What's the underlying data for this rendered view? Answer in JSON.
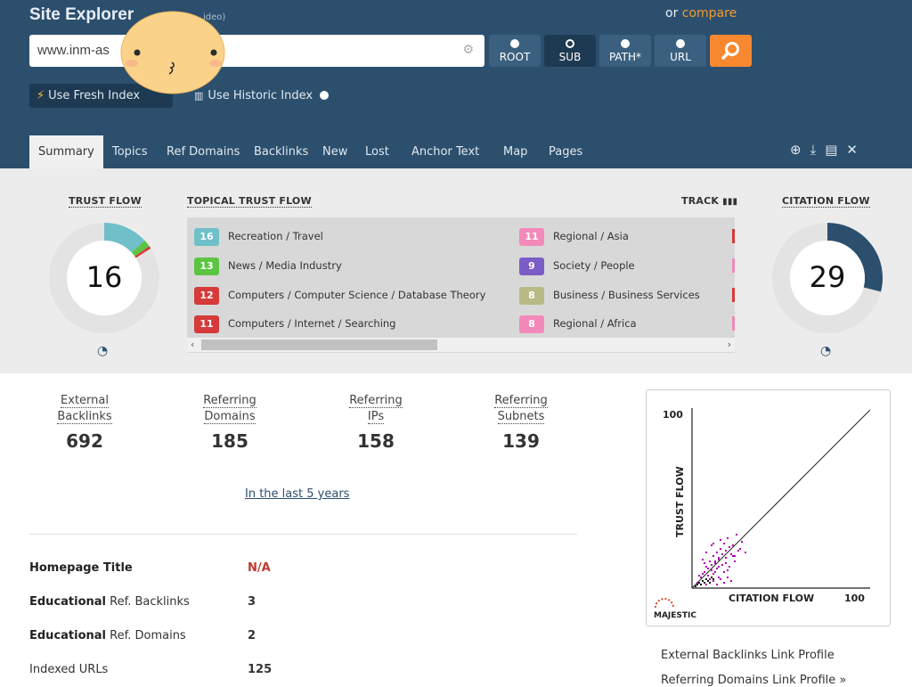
{
  "header": {
    "title": "Site Explorer",
    "title_suffix": "ideo)",
    "or_text": "or ",
    "compare_link": "compare",
    "search_value": "www.inm-as",
    "scopes": [
      {
        "label": "ROOT",
        "active": false
      },
      {
        "label": "SUB",
        "active": true
      },
      {
        "label": "PATH*",
        "active": false
      },
      {
        "label": "URL",
        "active": false
      }
    ],
    "fresh_index": "Use Fresh Index",
    "historic_index": "Use Historic Index"
  },
  "tabs": [
    "Summary",
    "Topics",
    "Ref Domains",
    "Backlinks",
    "New",
    "Lost",
    "Anchor Text",
    "Map",
    "Pages"
  ],
  "metrics": {
    "trust_flow_label": "TRUST FLOW",
    "trust_flow": "16",
    "topical_label": "TOPICAL TRUST FLOW",
    "track_label": "TRACK",
    "citation_flow_label": "CITATION FLOW",
    "citation_flow": "29",
    "topics": [
      {
        "score": "16",
        "name": "Recreation / Travel",
        "color": "#6fc0c8"
      },
      {
        "score": "13",
        "name": "News / Media Industry",
        "color": "#5cc443"
      },
      {
        "score": "12",
        "name": "Computers / Computer Science / Database Theory",
        "color": "#d63a3a"
      },
      {
        "score": "11",
        "name": "Computers / Internet / Searching",
        "color": "#d63a3a"
      },
      {
        "score": "11",
        "name": "Regional / Asia",
        "color": "#f389b8"
      },
      {
        "score": "9",
        "name": "Society / People",
        "color": "#7a5cc7"
      },
      {
        "score": "8",
        "name": "Business / Business Services",
        "color": "#b8ba86"
      },
      {
        "score": "8",
        "name": "Regional / Africa",
        "color": "#f389b8"
      }
    ]
  },
  "stats": [
    {
      "line1": "External",
      "line2": "Backlinks",
      "value": "692"
    },
    {
      "line1": "Referring",
      "line2": "Domains",
      "value": "185"
    },
    {
      "line1": "Referring",
      "line2": "IPs",
      "value": "158"
    },
    {
      "line1": "Referring",
      "line2": "Subnets",
      "value": "139"
    }
  ],
  "last_years": "In the last 5 years",
  "info": [
    {
      "bold": "Homepage Title",
      "rest": "",
      "value": "N/A",
      "value_color": "#c0392b"
    },
    {
      "bold": "Educational",
      "rest": " Ref. Backlinks",
      "value": "3",
      "value_color": "#333"
    },
    {
      "bold": "Educational",
      "rest": " Ref. Domains",
      "value": "2",
      "value_color": "#333"
    },
    {
      "bold": "",
      "rest": "Indexed URLs",
      "value": "125",
      "value_color": "#333"
    }
  ],
  "chart_data": {
    "type": "scatter",
    "xlabel": "CITATION FLOW",
    "ylabel": "TRUST FLOW",
    "xlim": [
      0,
      100
    ],
    "ylim": [
      0,
      100
    ],
    "x_tick": "100",
    "y_tick": "100",
    "brand": "MAJESTIC",
    "series": [
      {
        "color": "#b000b0",
        "x": [
          3,
          5,
          6,
          7,
          8,
          9,
          10,
          10,
          11,
          12,
          12,
          13,
          14,
          14,
          15,
          15,
          16,
          17,
          18,
          18,
          19,
          20,
          21,
          22,
          23,
          24,
          25,
          26,
          28,
          8,
          10,
          12,
          14,
          16,
          18,
          20,
          22,
          6,
          9,
          11,
          13,
          15,
          17,
          19,
          21,
          24,
          7,
          12,
          16,
          20,
          4,
          6,
          8,
          11,
          13,
          15,
          19,
          23,
          27,
          30
        ],
        "y": [
          3,
          6,
          4,
          9,
          12,
          7,
          15,
          5,
          10,
          18,
          8,
          14,
          20,
          11,
          16,
          6,
          22,
          13,
          25,
          9,
          17,
          28,
          12,
          19,
          24,
          15,
          30,
          21,
          26,
          2,
          3,
          4,
          2,
          5,
          3,
          6,
          4,
          8,
          11,
          13,
          15,
          17,
          19,
          21,
          23,
          18,
          14,
          25,
          27,
          10,
          7,
          16,
          20,
          24,
          9,
          12,
          14,
          18,
          22,
          20
        ]
      },
      {
        "color": "#111111",
        "x": [
          2,
          3,
          4,
          5,
          6,
          7,
          8,
          9,
          10,
          11,
          12
        ],
        "y": [
          1,
          2,
          3,
          2,
          4,
          3,
          5,
          4,
          3,
          6,
          5
        ]
      }
    ]
  },
  "link_profiles": [
    "External Backlinks Link Profile",
    "Referring Domains Link Profile »"
  ]
}
